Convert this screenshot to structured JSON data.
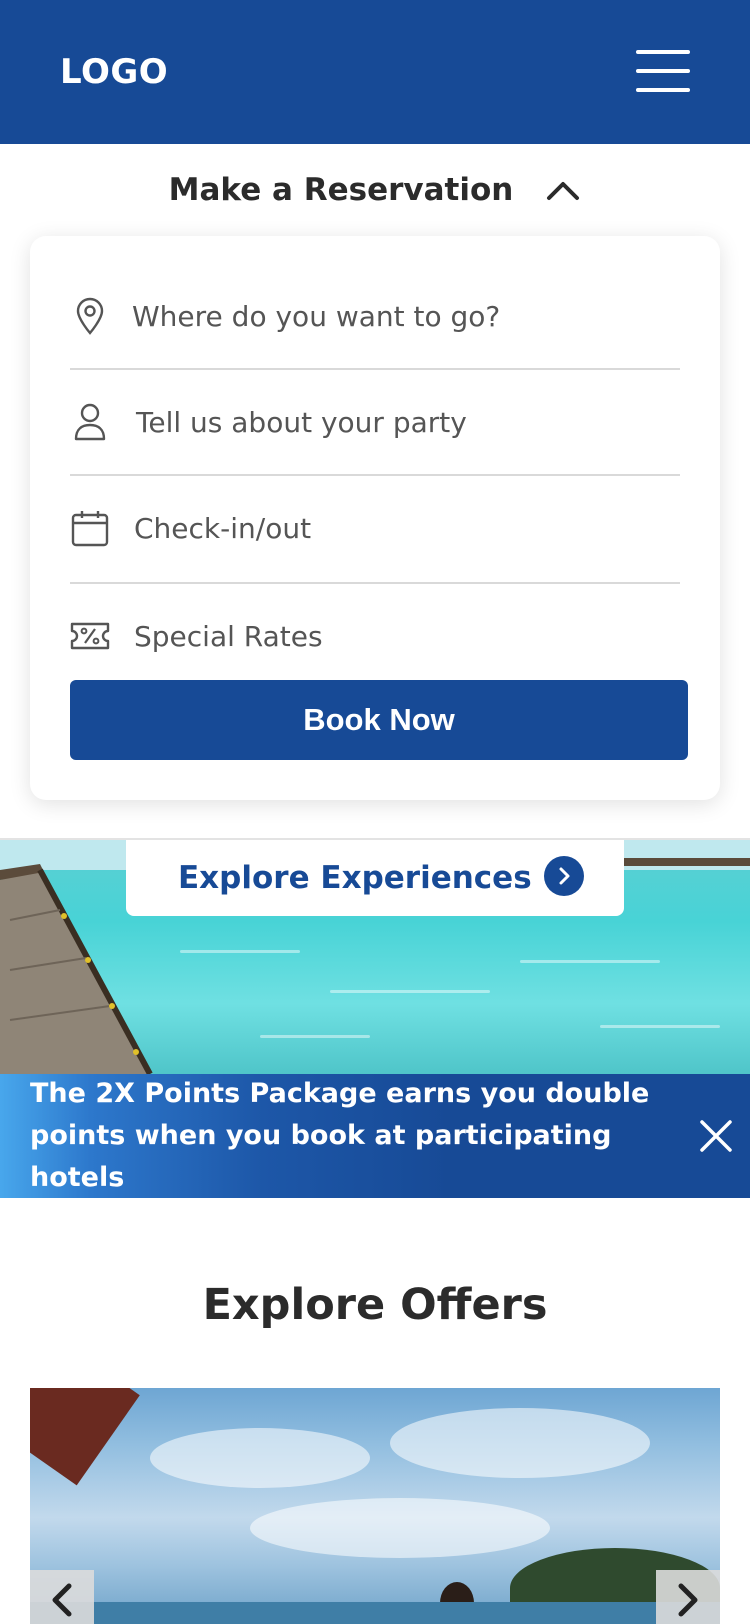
{
  "header": {
    "logo": "LOGO",
    "menu_icon": "hamburger-menu-icon",
    "background": "#174a96"
  },
  "reservation": {
    "title": "Make a Reservation",
    "toggle_icon": "chevron-up-icon",
    "fields": [
      {
        "icon": "location-pin-icon",
        "placeholder": "Where do you want to go?"
      },
      {
        "icon": "person-icon",
        "placeholder": "Tell us about your party"
      },
      {
        "icon": "calendar-icon",
        "placeholder": "Check-in/out"
      },
      {
        "icon": "discount-ticket-icon",
        "placeholder": "Special Rates"
      }
    ],
    "book_button": "Book Now"
  },
  "experiences": {
    "label": "Explore Experiences",
    "icon": "chevron-right-circle-icon"
  },
  "promo": {
    "text": "The 2X Points Package earns you double points when you book at participating hotels",
    "close_icon": "close-icon"
  },
  "offers": {
    "title": "Explore Offers",
    "prev_icon": "chevron-left-icon",
    "next_icon": "chevron-right-icon"
  },
  "colors": {
    "brand": "#174a96",
    "text": "#2b2b2b",
    "muted_text": "#555555"
  }
}
